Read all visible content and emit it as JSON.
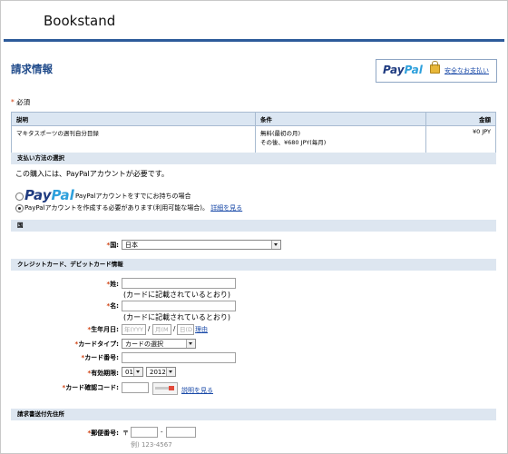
{
  "store_name": "Bookstand",
  "page_title": "請求情報",
  "paypal_logo": {
    "part1": "Pay",
    "part2": "Pal"
  },
  "secure_payment_link": "安全なお支払い",
  "required_note": {
    "mark": "*",
    "label": "必須"
  },
  "order_table": {
    "headers": [
      "説明",
      "条件",
      "金額"
    ],
    "rows": [
      {
        "description": "マキタスポーツの週刊自分目録",
        "terms_line1": "無料(最初の月)",
        "terms_line2": "その後、¥680 JPY(毎月)",
        "amount": "¥0 JPY"
      }
    ]
  },
  "payment_section": {
    "header": "支払い方法の選択",
    "intro": "この購入には、PayPalアカウントが必要です。",
    "option_existing": "PayPalアカウントをすでにお持ちの場合",
    "option_create": "PayPalアカウントを作成する必要があります(利用可能な場合)。",
    "details_link": "詳細を見る"
  },
  "country_section": {
    "header": "国",
    "label": "国:",
    "value": "日本"
  },
  "card_section": {
    "header": "クレジットカード、デビットカード情報",
    "last_name_label": "姓:",
    "last_name_hint": "(カードに記載されているとおり)",
    "first_name_label": "名:",
    "first_name_hint": "(カードに記載されているとおり)",
    "birthdate_label": "生年月日:",
    "birth_year_placeholder": "年(YYY",
    "birth_month_placeholder": "月(M",
    "birth_day_placeholder": "日(D",
    "birthdate_reason_link": "理由",
    "card_type_label": "カードタイプ:",
    "card_type_value": "カードの選択",
    "card_number_label": "カード番号:",
    "expiry_label": "有効期限:",
    "expiry_month": "01",
    "expiry_year": "2012",
    "cvv_label": "カード確認コード:",
    "cvv_link": "説明を見る",
    "slash": "/"
  },
  "billing_section": {
    "header": "請求書送付先住所",
    "postal_label": "郵便番号:",
    "postal_mark": "〒",
    "postal_dash": "-",
    "postal_example": "例) 123-4567"
  }
}
